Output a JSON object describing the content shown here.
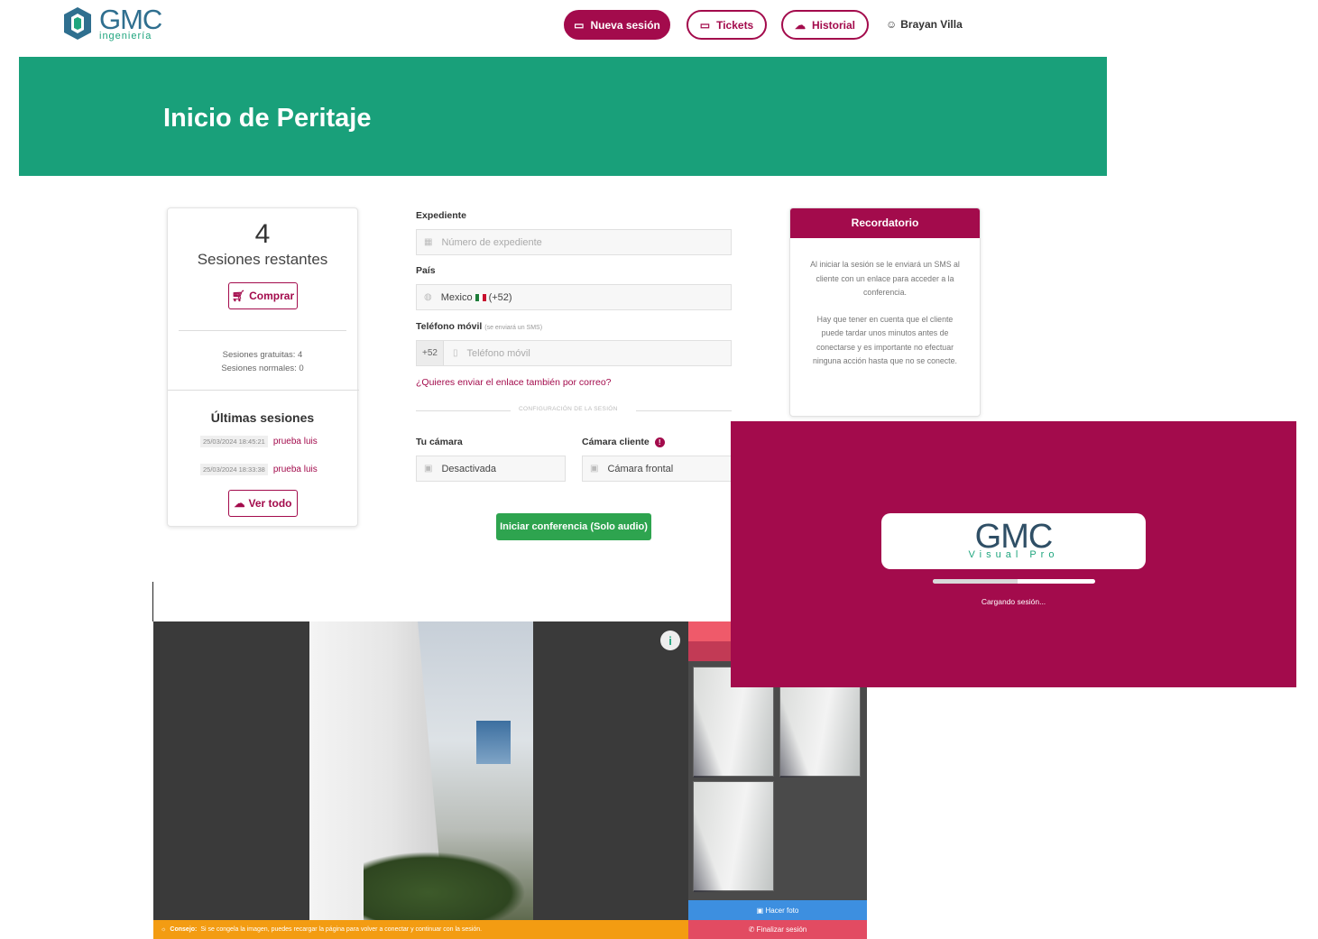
{
  "brand": {
    "name": "GMC",
    "tagline": "ingeniería"
  },
  "nav": {
    "new_session": "Nueva sesión",
    "tickets": "Tickets",
    "history": "Historial",
    "user": "Brayan Villa"
  },
  "banner": {
    "title": "Inicio de Peritaje"
  },
  "sessions_card": {
    "remaining_count": "4",
    "remaining_label": "Sesiones restantes",
    "buy_label": "Comprar",
    "free_sessions": "Sesiones gratuitas: 4",
    "normal_sessions": "Sesiones normales: 0",
    "recent_title": "Últimas sesiones",
    "recent": [
      {
        "date": "25/03/2024 18:45:21",
        "name": "prueba luis"
      },
      {
        "date": "25/03/2024 18:33:38",
        "name": "prueba luis"
      }
    ],
    "view_all_label": "Ver todo"
  },
  "form": {
    "file_label": "Expediente",
    "file_placeholder": "Número de expediente",
    "country_label": "País",
    "country_value": "Mexico",
    "country_code": "(+52)",
    "phone_label": "Teléfono móvil",
    "phone_note": "(se enviará un SMS)",
    "phone_prefix": "+52",
    "phone_placeholder": "Teléfono móvil",
    "email_link": "¿Quieres enviar el enlace también por correo?",
    "config_separator": "CONFIGURACIÓN DE LA SESIÓN",
    "your_camera_label": "Tu cámara",
    "your_camera_value": "Desactivada",
    "client_camera_label": "Cámara cliente",
    "client_camera_value": "Cámara frontal",
    "start_button": "Iniciar conferencia (Solo audio)"
  },
  "reminder": {
    "title": "Recordatorio",
    "p1": "Al iniciar la sesión se le enviará un SMS al cliente con un enlace para acceder a la conferencia.",
    "p2": "Hay que tener en cuenta que el cliente puede tardar unos minutos antes de conectarse y es importante no efectuar ninguna acción hasta que no se conecte."
  },
  "video_session": {
    "take_photo": "Hacer foto",
    "end_session": "Finalizar sesión",
    "tip_label": "Consejo:",
    "tip_text": "Si se congela la imagen, puedes recargar la página para volver a conectar y continuar con la sesión."
  },
  "loader": {
    "logo": "GMC",
    "logo_sub": "Visual Pro",
    "status": "Cargando sesión...",
    "progress_fraction": 0.52
  },
  "colors": {
    "brand_primary": "#a30b4c",
    "banner_green": "#19a07a",
    "start_green": "#2ea44f"
  }
}
